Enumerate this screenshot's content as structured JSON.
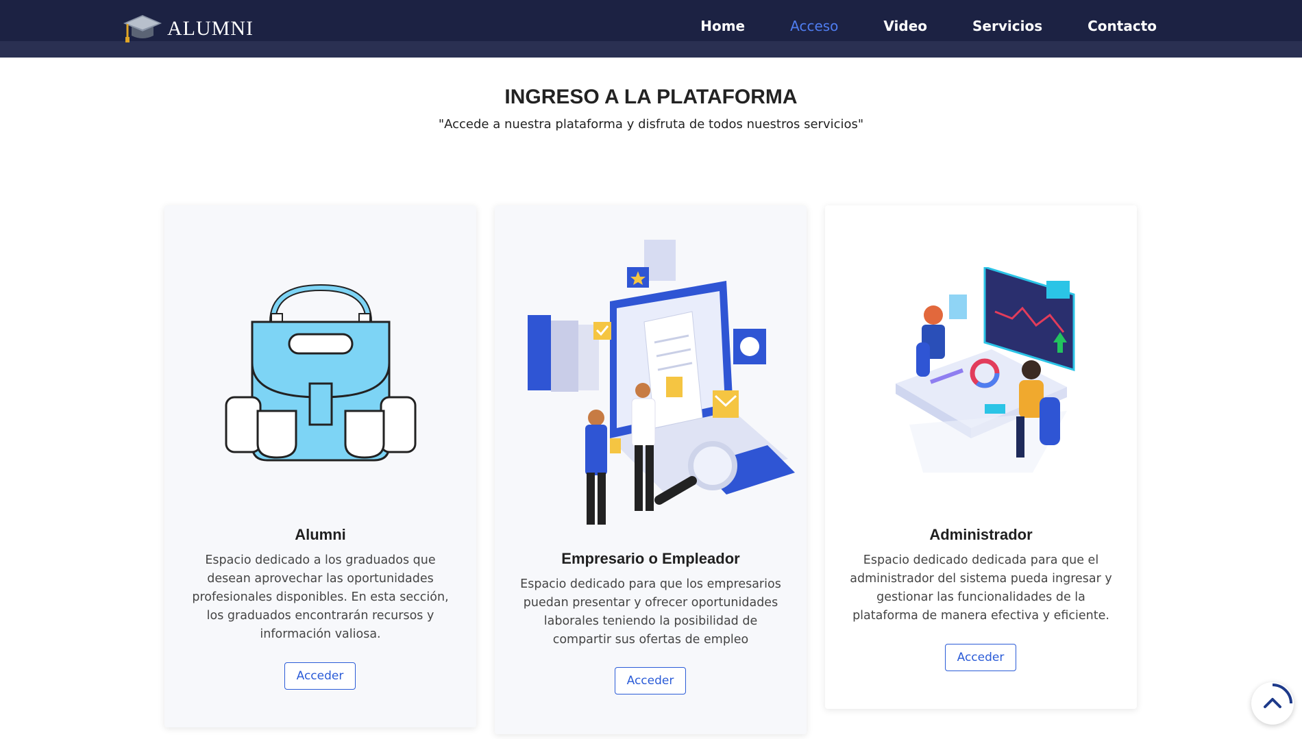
{
  "brand": {
    "name": "ALUMNI"
  },
  "nav": {
    "items": [
      {
        "label": "Home"
      },
      {
        "label": "Acceso"
      },
      {
        "label": "Video"
      },
      {
        "label": "Servicios"
      },
      {
        "label": "Contacto"
      }
    ],
    "active": "Acceso",
    "active_color": "#4f7df0"
  },
  "section": {
    "title": "INGRESO A LA PLATAFORMA",
    "subtitle": "\"Accede a nuestra plataforma y disfruta de todos nuestros servicios\""
  },
  "cards": [
    {
      "title": "Alumni",
      "text": "Espacio dedicado a los graduados que desean aprovechar las oportunidades profesionales disponibles. En esta sección, los graduados encontrarán recursos y información valiosa.",
      "button": "Acceder",
      "image": "backpack-illustration"
    },
    {
      "title": "Empresario o Empleador",
      "text": "Espacio dedicado para que los empresarios puedan presentar y ofrecer oportunidades laborales teniendo la posibilidad de compartir sus ofertas de empleo",
      "button": "Acceder",
      "image": "employer-illustration"
    },
    {
      "title": "Administrador",
      "text": "Espacio dedicado dedicada para que el administrador del sistema pueda ingresar y gestionar las funcionalidades de la plataforma de manera efectiva y eficiente.",
      "button": "Acceder",
      "image": "admin-illustration"
    }
  ],
  "colors": {
    "header_bg": "#1c2243",
    "button_accent": "#2a5bd7"
  },
  "icons": {
    "scroll_top": "chevron-up-icon",
    "brand": "graduation-cap-icon"
  }
}
